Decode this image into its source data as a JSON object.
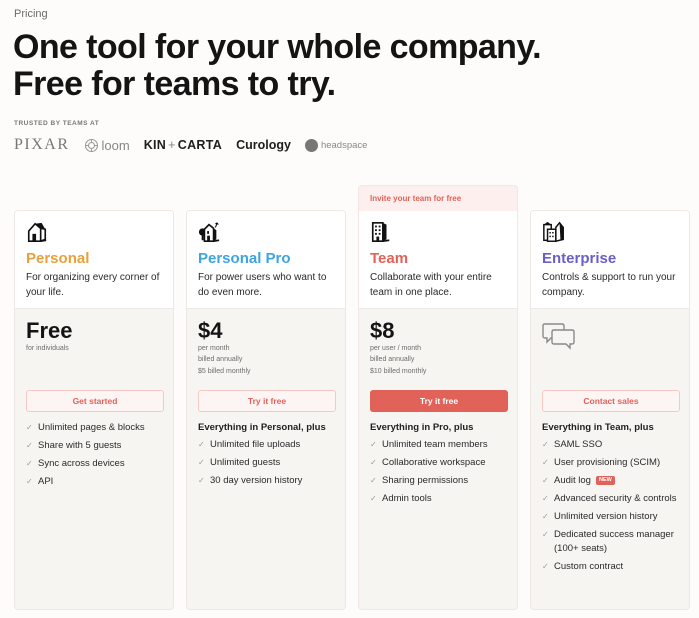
{
  "page": {
    "eyebrow": "Pricing",
    "headline_line1": "One tool for your whole company.",
    "headline_line2": "Free for teams to try.",
    "trusted_label": "TRUSTED BY TEAMS AT",
    "logos": {
      "pixar": "PIXAR",
      "loom": "loom",
      "kin": "KIN",
      "kin_plus": "+",
      "carta": "CARTA",
      "curology": "Curology",
      "headspace": "headspace"
    }
  },
  "colors": {
    "personal": "#e9a23b",
    "personal_pro": "#3ea4e0",
    "team": "#e16259",
    "enterprise": "#6a5fc6",
    "accent": "#e16259"
  },
  "plans": [
    {
      "name": "Personal",
      "icon": "house-icon",
      "description": "For organizing every corner of your life.",
      "price": "Free",
      "price_sub": "for individuals",
      "cta": "Get started",
      "features_heading": "",
      "features": [
        "Unlimited pages & blocks",
        "Share with 5 guests",
        "Sync across devices",
        "API"
      ]
    },
    {
      "name": "Personal Pro",
      "icon": "house-with-tree-icon",
      "description": "For power users who want to do even more.",
      "price": "$4",
      "price_sub": "per month",
      "price_sub_2": "billed annually",
      "price_monthly": "$5 billed monthly",
      "cta": "Try it free",
      "features_heading": "Everything in Personal, plus",
      "features": [
        "Unlimited file uploads",
        "Unlimited guests",
        "30 day version history"
      ]
    },
    {
      "name": "Team",
      "icon": "office-building-icon",
      "ribbon": "Invite your team for free",
      "description": "Collaborate with your entire team in one place.",
      "price": "$8",
      "price_sub": "per user / month",
      "price_sub_2": "billed annually",
      "price_monthly": "$10 billed monthly",
      "cta": "Try it free",
      "features_heading": "Everything in Pro, plus",
      "features": [
        "Unlimited team members",
        "Collaborative workspace",
        "Sharing permissions",
        "Admin tools"
      ]
    },
    {
      "name": "Enterprise",
      "icon": "city-buildings-icon",
      "description": "Controls & support to run your company.",
      "price_icon": "chat-bubbles-icon",
      "cta": "Contact sales",
      "features_heading": "Everything in Team, plus",
      "features": [
        "SAML SSO",
        "User provisioning (SCIM)",
        "Audit log",
        "Advanced security & controls",
        "Unlimited version history",
        "Dedicated success manager (100+ seats)",
        "Custom contract"
      ],
      "new_badge": "NEW"
    }
  ],
  "check_glyph": "✓"
}
